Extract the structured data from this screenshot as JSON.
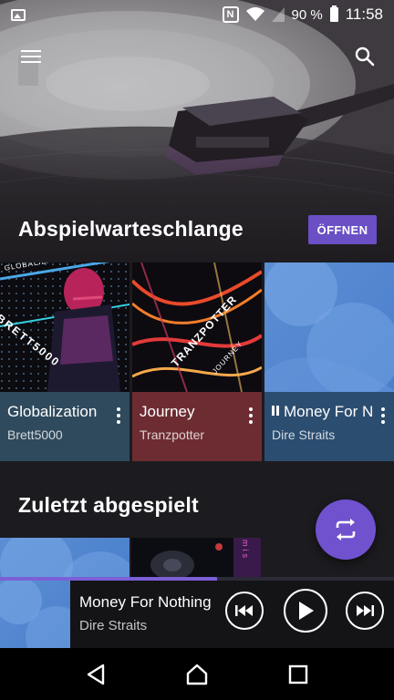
{
  "status_bar": {
    "battery_percent": "90 %",
    "time": "11:58",
    "icons": [
      "image-icon",
      "nfc-icon",
      "wifi-icon",
      "signal-icon",
      "battery-icon"
    ]
  },
  "header": {
    "menu_icon": "hamburger-menu-icon",
    "search_icon": "search-icon"
  },
  "queue": {
    "title": "Abspielwarteschlange",
    "open_label": "ÖFFNEN",
    "cards": [
      {
        "title": "Globalization",
        "artist": "Brett5000",
        "art_text": "BRETT5000",
        "art_text2": "GLOBALIZATION",
        "color": "#2f4a5d"
      },
      {
        "title": "Journey",
        "artist": "Tranzpotter",
        "art_text": "TRANZPOTTER",
        "art_text2": "JOURNEY",
        "color": "#6d2c32"
      },
      {
        "title": "Money For Nothing",
        "artist": "Dire Straits",
        "playing": true,
        "color": "#2b4d70"
      }
    ]
  },
  "recent": {
    "title": "Zuletzt abgespielt",
    "art_text": "mis"
  },
  "fab": {
    "icon": "repeat-icon"
  },
  "mini_player": {
    "title": "Money For Nothing",
    "artist": "Dire Straits",
    "progress": 0.55
  },
  "nav_bar": {
    "icons": [
      "back-icon",
      "home-icon",
      "recents-icon"
    ]
  },
  "colors": {
    "accent": "#6b4fc4",
    "fab": "#7052cf",
    "background": "#1c1b1f"
  }
}
